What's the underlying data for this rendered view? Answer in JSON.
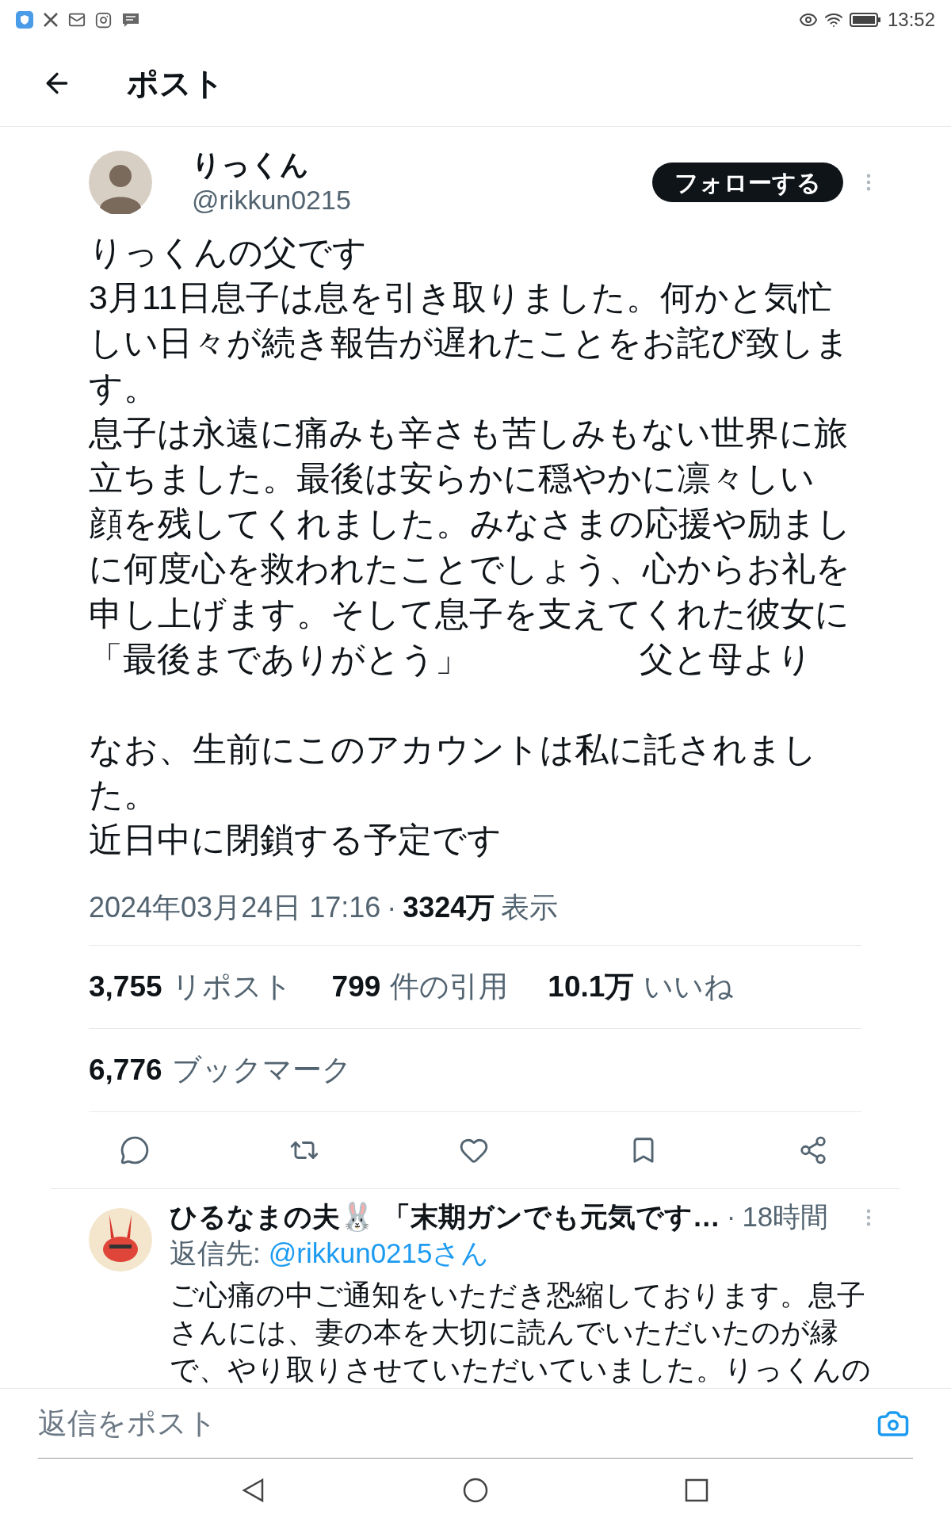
{
  "status_bar": {
    "time": "13:52"
  },
  "header": {
    "title": "ポスト"
  },
  "post": {
    "author": {
      "name": "りっくん",
      "handle": "@rikkun0215"
    },
    "follow_button": "フォローする",
    "paragraphs": [
      [
        "りっくんの父です",
        "3月11日息子は息を引き取りました。何かと気忙",
        "しい日々が続き報告が遅れたことをお詫び致しま",
        "す。",
        "息子は永遠に痛みも辛さも苦しみもない世界に旅",
        "立ちました。最後は安らかに穏やかに凛々しい",
        "顔を残してくれました。みなさまの応援や励まし",
        "に何度心を救われたことでしょう、心からお礼を",
        "申し上げます。そして息子を支えてくれた彼女に",
        "「最後までありがとう」　　　　　父と母より"
      ],
      [
        "なお、生前にこのアカウントは私に託されまし",
        "た。",
        "近日中に閉鎖する予定です"
      ]
    ],
    "timestamp": "2024年03月24日 17:16",
    "separator": "·",
    "views_count": "3324万",
    "views_label": "表示",
    "stats": [
      {
        "count": "3,755",
        "label": "リポスト"
      },
      {
        "count": "799",
        "label": "件の引用"
      },
      {
        "count": "10.1万",
        "label": "いいね"
      }
    ],
    "bookmarks": {
      "count": "6,776",
      "label": "ブックマーク"
    }
  },
  "replies": [
    {
      "name": "ひるなまの夫🐰 「末期ガンでも元気です…",
      "separator": "·",
      "time": "18時間",
      "reply_to_label": "返信先:",
      "reply_to_handle": "@rikkun0215さん",
      "text_lines": [
        "ご心痛の中ご通知をいただき恐縮しております。息子",
        "さんには、妻の本を大切に読んでいただいたのが縁",
        "で、やり取りさせていただいていました。りっくんの"
      ]
    }
  ],
  "compose": {
    "placeholder": "返信をポスト"
  }
}
